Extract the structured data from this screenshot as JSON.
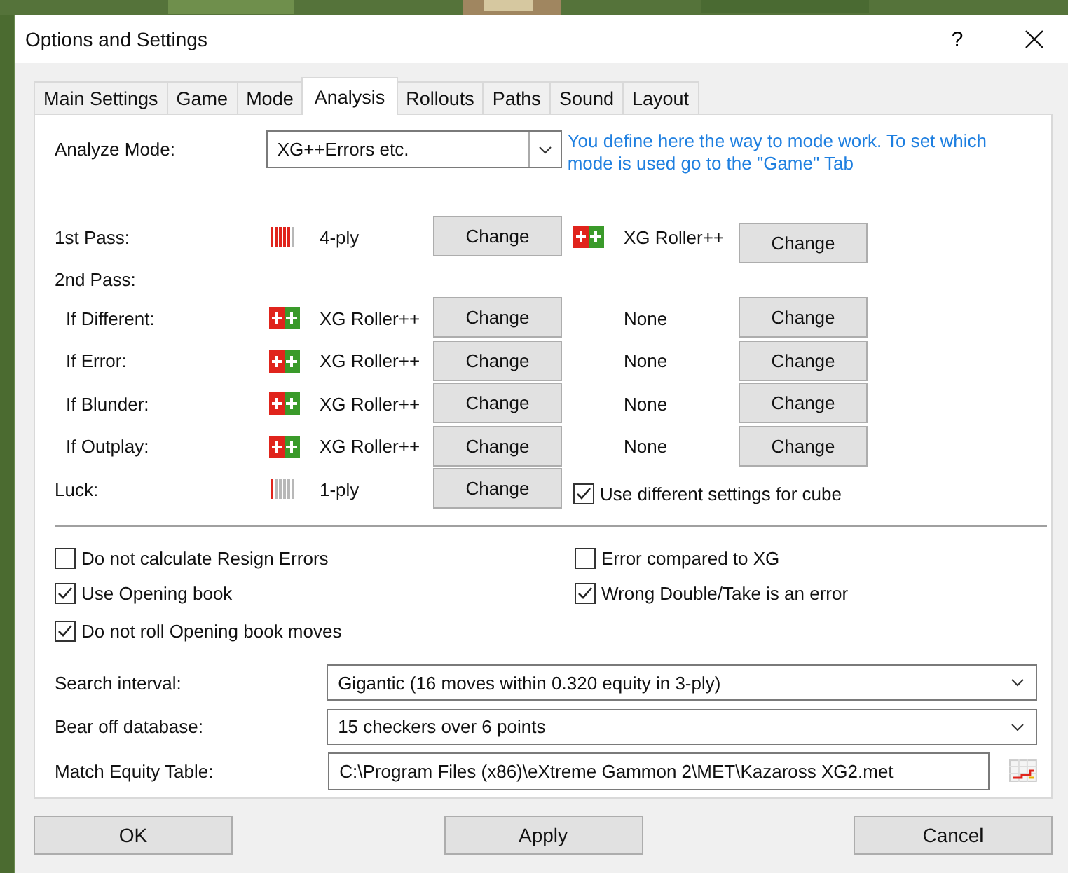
{
  "window": {
    "title": "Options and Settings",
    "help": "?"
  },
  "tabs": [
    {
      "label": "Main Settings",
      "selected": false
    },
    {
      "label": "Game",
      "selected": false
    },
    {
      "label": "Mode",
      "selected": false
    },
    {
      "label": "Analysis",
      "selected": true
    },
    {
      "label": "Rollouts",
      "selected": false
    },
    {
      "label": "Paths",
      "selected": false
    },
    {
      "label": "Sound",
      "selected": false
    },
    {
      "label": "Layout",
      "selected": false
    }
  ],
  "analyze_mode": {
    "label": "Analyze Mode:",
    "value": "XG++Errors etc.",
    "note": "You define here the way to mode work. To set which mode is used go to the \"Game\" Tab"
  },
  "passes": [
    {
      "kind": "pass",
      "label": "1st Pass:",
      "indent": false,
      "primary": {
        "icon": {
          "kind": "ply_full"
        },
        "text": "4-ply",
        "button": "Change"
      },
      "secondary": {
        "icon": {
          "kind": "roller"
        },
        "text": "XG Roller++",
        "button": "Change"
      }
    },
    {
      "kind": "header",
      "label": "2nd Pass:",
      "indent": false
    },
    {
      "kind": "pass",
      "label": "If Different:",
      "indent": true,
      "primary": {
        "icon": {
          "kind": "roller"
        },
        "text": "XG Roller++",
        "button": "Change"
      },
      "secondary": {
        "text": "None",
        "button": "Change"
      }
    },
    {
      "kind": "pass",
      "label": "If Error:",
      "indent": true,
      "primary": {
        "icon": {
          "kind": "roller"
        },
        "text": "XG Roller++",
        "button": "Change"
      },
      "secondary": {
        "text": "None",
        "button": "Change"
      }
    },
    {
      "kind": "pass",
      "label": "If Blunder:",
      "indent": true,
      "primary": {
        "icon": {
          "kind": "roller"
        },
        "text": "XG Roller++",
        "button": "Change"
      },
      "secondary": {
        "text": "None",
        "button": "Change"
      }
    },
    {
      "kind": "pass",
      "label": "If Outplay:",
      "indent": true,
      "primary": {
        "icon": {
          "kind": "roller"
        },
        "text": "XG Roller++",
        "button": "Change"
      },
      "secondary": {
        "text": "None",
        "button": "Change"
      }
    },
    {
      "kind": "pass",
      "label": "Luck:",
      "indent": false,
      "primary": {
        "icon": {
          "kind": "ply_low"
        },
        "text": "1-ply",
        "button": "Change"
      },
      "checkbox": {
        "label": "Use different settings for cube",
        "checked": true
      }
    }
  ],
  "options": [
    [
      {
        "label": "Do not calculate Resign Errors",
        "checked": false
      },
      {
        "label": "Error compared to XG",
        "checked": false
      }
    ],
    [
      {
        "label": "Use Opening book",
        "checked": true
      },
      {
        "label": "Wrong Double/Take is an error",
        "checked": true
      }
    ],
    [
      {
        "label": "Do not roll Opening book moves",
        "checked": true
      }
    ]
  ],
  "fields": [
    {
      "kind": "dropdown",
      "label": "Search interval:",
      "value": "Gigantic (16 moves within 0.320 equity in 3-ply)"
    },
    {
      "kind": "dropdown",
      "label": "Bear off database:",
      "value": "15 checkers over 6 points"
    },
    {
      "kind": "file",
      "label": "Match Equity Table:",
      "value": "C:\\Program Files (x86)\\eXtreme Gammon 2\\MET\\Kazaross XG2.met"
    }
  ],
  "buttons": [
    "OK",
    "Apply",
    "Cancel"
  ]
}
